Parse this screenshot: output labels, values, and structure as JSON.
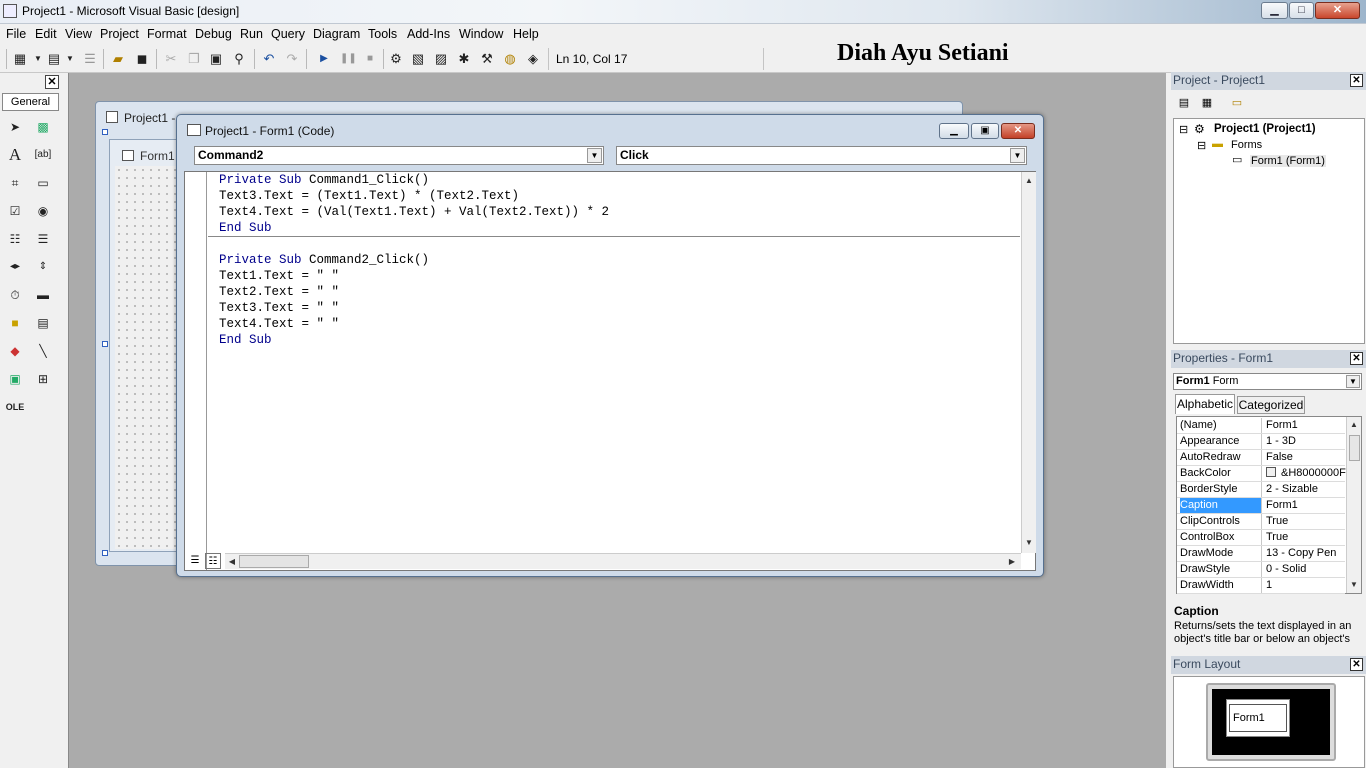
{
  "window": {
    "title": "Project1 - Microsoft Visual Basic [design]",
    "min": "▁",
    "max": "□",
    "close": "✕"
  },
  "menu": [
    "File",
    "Edit",
    "View",
    "Project",
    "Format",
    "Debug",
    "Run",
    "Query",
    "Diagram",
    "Tools",
    "Add-Ins",
    "Window",
    "Help"
  ],
  "toolbar": {
    "position": "Ln 10, Col 17"
  },
  "author": "Diah Ayu Setiani",
  "toolbox": {
    "close": "✕",
    "tab": "General"
  },
  "project_window": {
    "title": "Project1 -",
    "form_title": "Form1"
  },
  "code_window": {
    "title": "Project1 - Form1 (Code)",
    "object_combo": "Command2",
    "procedure_combo": "Click",
    "lines": [
      {
        "kw": "Private Sub",
        "text": " Command1_Click()"
      },
      {
        "kw": "",
        "text": "Text3.Text = (Text1.Text) * (Text2.Text)"
      },
      {
        "kw": "",
        "text": "Text4.Text = (Val(Text1.Text) + Val(Text2.Text)) * 2"
      },
      {
        "kw": "End Sub",
        "text": ""
      },
      {
        "kw": "",
        "text": ""
      },
      {
        "kw": "Private Sub",
        "text": " Command2_Click()"
      },
      {
        "kw": "",
        "text": "Text1.Text = \" \""
      },
      {
        "kw": "",
        "text": "Text2.Text = \" \""
      },
      {
        "kw": "",
        "text": "Text3.Text = \" \""
      },
      {
        "kw": "",
        "text": "Text4.Text = \" \""
      },
      {
        "kw": "End Sub",
        "text": ""
      }
    ]
  },
  "project_explorer": {
    "title": "Project - Project1",
    "root": "Project1 (Project1)",
    "folder": "Forms",
    "item": "Form1 (Form1)"
  },
  "properties": {
    "title": "Properties - Form1",
    "object_name": "Form1",
    "object_type": "Form",
    "tabs": [
      "Alphabetic",
      "Categorized"
    ],
    "rows": [
      {
        "name": "(Name)",
        "value": "Form1"
      },
      {
        "name": "Appearance",
        "value": "1 - 3D"
      },
      {
        "name": "AutoRedraw",
        "value": "False"
      },
      {
        "name": "BackColor",
        "value": "&H8000000F"
      },
      {
        "name": "BorderStyle",
        "value": "2 - Sizable"
      },
      {
        "name": "Caption",
        "value": "Form1"
      },
      {
        "name": "ClipControls",
        "value": "True"
      },
      {
        "name": "ControlBox",
        "value": "True"
      },
      {
        "name": "DrawMode",
        "value": "13 - Copy Pen"
      },
      {
        "name": "DrawStyle",
        "value": "0 - Solid"
      },
      {
        "name": "DrawWidth",
        "value": "1"
      }
    ],
    "selected_row": "Caption",
    "desc_title": "Caption",
    "desc_line1": "Returns/sets the text displayed in an",
    "desc_line2": "object's title bar or below an object's"
  },
  "form_layout": {
    "title": "Form Layout",
    "form_label": "Form1"
  },
  "colors": {
    "selected": "#3399ff",
    "keyword": "#00008b",
    "mdi_bg": "#ababab"
  }
}
